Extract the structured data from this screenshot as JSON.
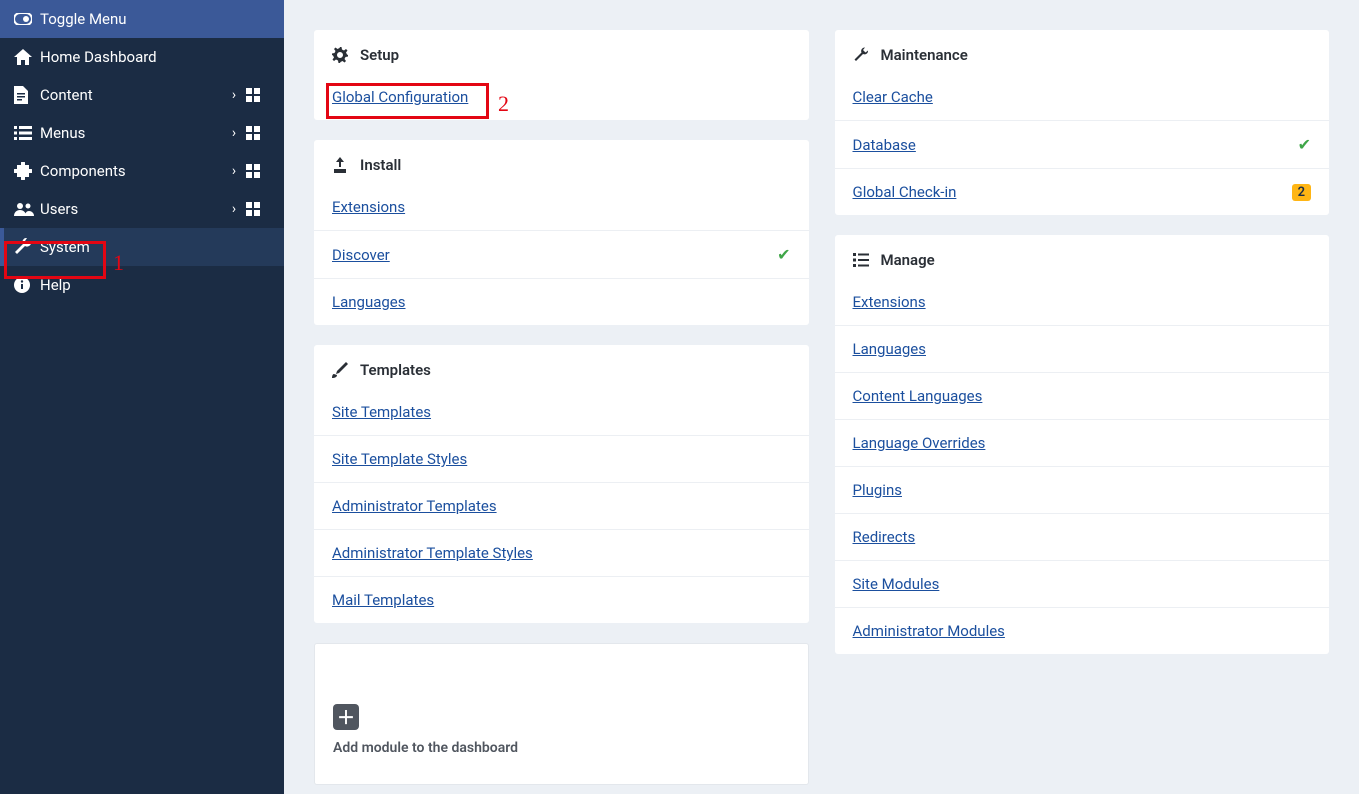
{
  "sidebar": {
    "toggle_label": "Toggle Menu",
    "items": [
      {
        "icon": "home",
        "label": "Home Dashboard",
        "expandable": false
      },
      {
        "icon": "file",
        "label": "Content",
        "expandable": true
      },
      {
        "icon": "list",
        "label": "Menus",
        "expandable": true
      },
      {
        "icon": "puzzle",
        "label": "Components",
        "expandable": true
      },
      {
        "icon": "users",
        "label": "Users",
        "expandable": true
      },
      {
        "icon": "wrench",
        "label": "System",
        "expandable": false,
        "active": true
      },
      {
        "icon": "info",
        "label": "Help",
        "expandable": false
      }
    ]
  },
  "annotations": {
    "a1": "1",
    "a2": "2"
  },
  "left_panels": {
    "setup": {
      "title": "Setup",
      "links": [
        {
          "label": "Global Configuration"
        }
      ]
    },
    "install": {
      "title": "Install",
      "links": [
        {
          "label": "Extensions"
        },
        {
          "label": "Discover",
          "check": true
        },
        {
          "label": "Languages"
        }
      ]
    },
    "templates": {
      "title": "Templates",
      "links": [
        {
          "label": "Site Templates"
        },
        {
          "label": "Site Template Styles"
        },
        {
          "label": "Administrator Templates"
        },
        {
          "label": "Administrator Template Styles"
        },
        {
          "label": "Mail Templates"
        }
      ]
    },
    "add_module_label": "Add module to the dashboard"
  },
  "right_panels": {
    "maintenance": {
      "title": "Maintenance",
      "links": [
        {
          "label": "Clear Cache"
        },
        {
          "label": "Database",
          "check": true
        },
        {
          "label": "Global Check-in",
          "badge": "2"
        }
      ]
    },
    "manage": {
      "title": "Manage",
      "links": [
        {
          "label": "Extensions"
        },
        {
          "label": "Languages"
        },
        {
          "label": "Content Languages"
        },
        {
          "label": "Language Overrides"
        },
        {
          "label": "Plugins"
        },
        {
          "label": "Redirects"
        },
        {
          "label": "Site Modules"
        },
        {
          "label": "Administrator Modules"
        }
      ]
    }
  }
}
